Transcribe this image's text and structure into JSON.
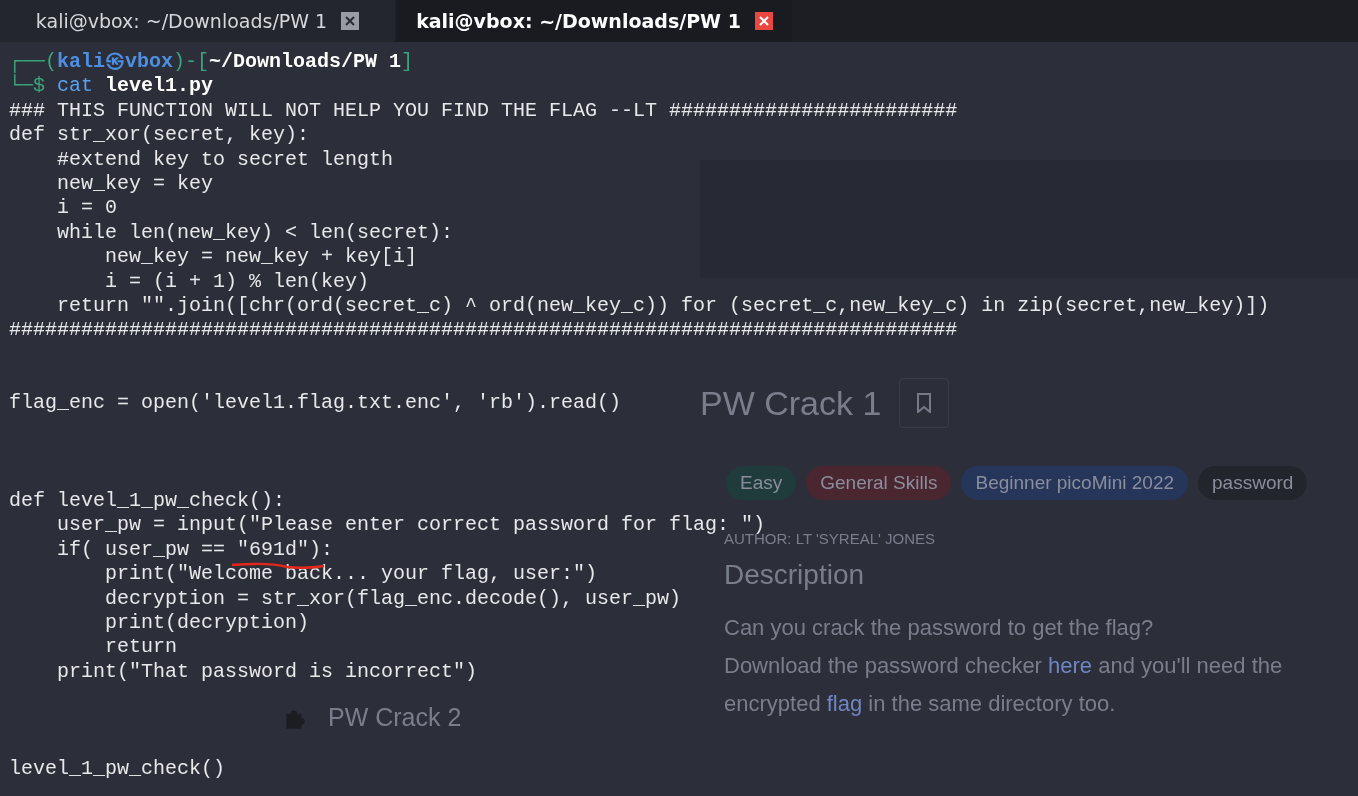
{
  "tabs": [
    {
      "title": "kali@vbox: ~/Downloads/PW 1",
      "selected": false
    },
    {
      "title": "kali@vbox: ~/Downloads/PW 1",
      "selected": true
    }
  ],
  "prompt": {
    "frame_open": "┌──(",
    "user": "kali",
    "at": "㉿",
    "host": "vbox",
    "separator": ")-[",
    "path": "~/Downloads/PW 1",
    "frame_close": "]",
    "sigil": "└─$",
    "command": "cat",
    "argument": "level1.py"
  },
  "lines": [
    {
      "kind": "code",
      "text": "### THIS FUNCTION WILL NOT HELP YOU FIND THE FLAG --LT ########################"
    },
    {
      "kind": "code",
      "text": "def str_xor(secret, key):"
    },
    {
      "kind": "code",
      "text": "    #extend key to secret length"
    },
    {
      "kind": "code",
      "text": "    new_key = key"
    },
    {
      "kind": "code",
      "text": "    i = 0"
    },
    {
      "kind": "code",
      "text": "    while len(new_key) < len(secret):"
    },
    {
      "kind": "code",
      "text": "        new_key = new_key + key[i]"
    },
    {
      "kind": "code",
      "text": "        i = (i + 1) % len(key)"
    },
    {
      "kind": "code",
      "text": "    return \"\".join([chr(ord(secret_c) ^ ord(new_key_c)) for (secret_c,new_key_c) in zip(secret,new_key)])"
    },
    {
      "kind": "code",
      "text": "###############################################################################"
    },
    {
      "kind": "blank"
    },
    {
      "kind": "blank"
    },
    {
      "kind": "code",
      "text": "flag_enc = open('level1.flag.txt.enc', 'rb').read()"
    },
    {
      "kind": "blank"
    },
    {
      "kind": "blank"
    },
    {
      "kind": "blank"
    },
    {
      "kind": "code",
      "text": "def level_1_pw_check():"
    },
    {
      "kind": "code",
      "text": "    user_pw = input(\"Please enter correct password for flag: \")"
    },
    {
      "kind": "code",
      "text": "    if( user_pw == ",
      "underlined": "\"691d\")",
      "after": ":"
    },
    {
      "kind": "code",
      "text": "        print(\"Welcome back... your flag, user:\")"
    },
    {
      "kind": "code",
      "text": "        decryption = str_xor(flag_enc.decode(), user_pw)"
    },
    {
      "kind": "code",
      "text": "        print(decryption)"
    },
    {
      "kind": "code",
      "text": "        return"
    },
    {
      "kind": "code",
      "text": "    print(\"That password is incorrect\")"
    },
    {
      "kind": "blank"
    },
    {
      "kind": "blank"
    },
    {
      "kind": "blank"
    },
    {
      "kind": "code",
      "text": "level_1_pw_check()"
    }
  ],
  "background_page": {
    "sidebar_item": "PW Crack 2",
    "title": "PW Crack 1",
    "tags": [
      {
        "label": "Easy",
        "color": "#1f3b3c"
      },
      {
        "label": "General Skills",
        "color": "#4a2630"
      },
      {
        "label": "Beginner picoMini 2022",
        "color": "#26355a"
      },
      {
        "label": "password",
        "color": "#23252d"
      }
    ],
    "author": "AUTHOR: LT 'SYREAL' JONES",
    "heading": "Description",
    "question": "Can you crack the password to get the flag?",
    "download": {
      "text_1": "Download the password checker ",
      "link_1": "here",
      "text_2": " and you'll need the encrypted ",
      "link_2": "flag",
      "text_3": " in the same directory too."
    }
  }
}
